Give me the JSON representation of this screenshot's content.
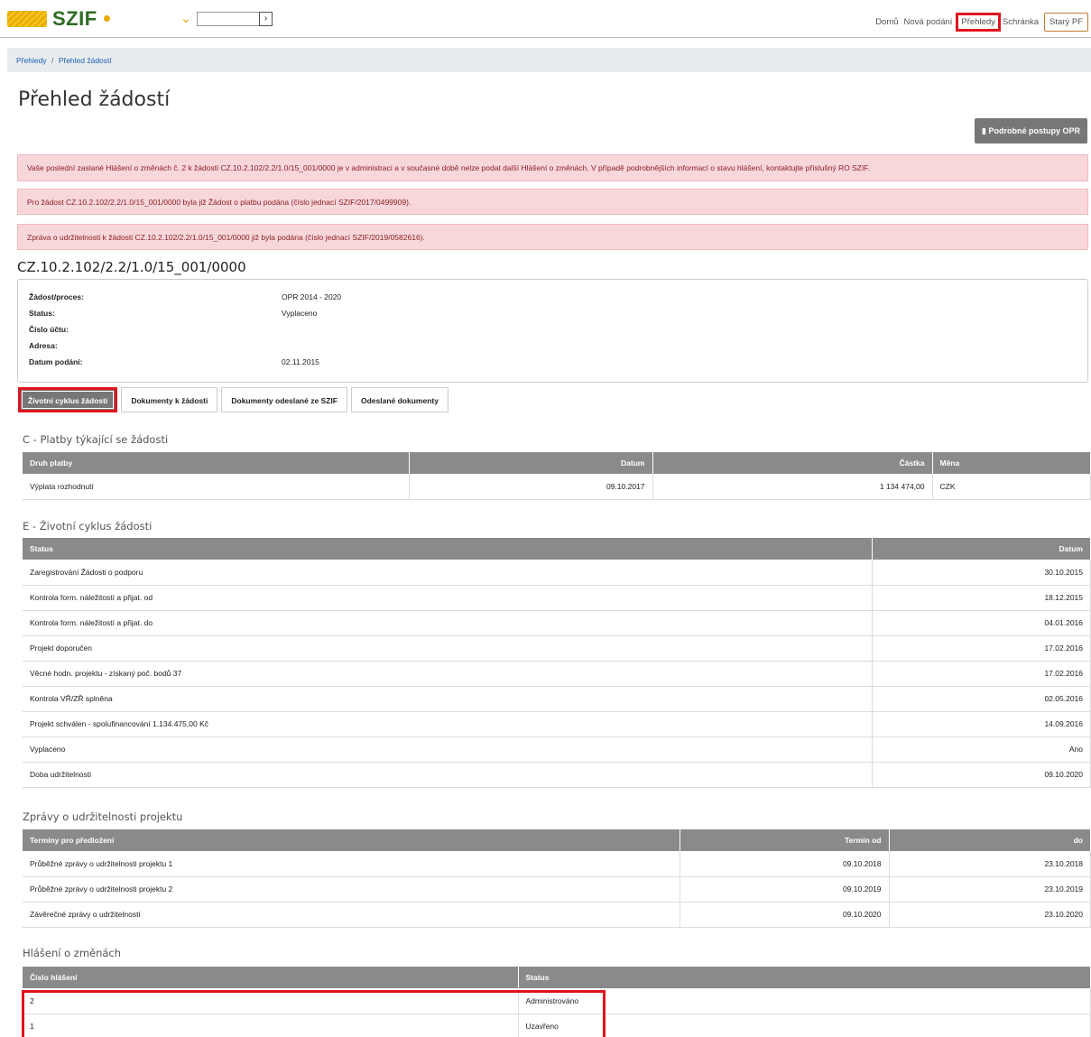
{
  "header": {
    "logo_text": "SZIF",
    "nav": [
      "Domů",
      "Nová podání",
      "Přehledy",
      "Schránka"
    ],
    "old_portal": "Starý PF",
    "go_symbol": "›"
  },
  "breadcrumb": [
    "Přehledy",
    "Přehled žádostí"
  ],
  "breadcrumb_sep": "/",
  "page_title": "Přehled žádostí",
  "postupy_button": "Podrobné postupy OPR",
  "alerts": [
    "Vaše poslední zaslané Hlášení o změnách č. 2 k žádosti CZ.10.2.102/2.2/1.0/15_001/0000     je v administraci a v současné době nelze podat další Hlášení o změnách. V případě podrobnějších informací o stavu hlášení, kontaktujte příslušný RO SZIF.",
    "Pro žádost CZ.10.2.102/2.2/1.0/15_001/0000     byla již Žádost o platbu podána (číslo jednací SZIF/2017/0499909).",
    "Zpráva o udržitelnosti k žádosti CZ.10.2.102/2.2/1.0/15_001/0000     již byla podána (číslo jednací SZIF/2019/0582616)."
  ],
  "application_id": "CZ.10.2.102/2.2/1.0/15_001/0000",
  "info": [
    {
      "key": "Žádost/proces:",
      "value": "OPR 2014 - 2020"
    },
    {
      "key": "Status:",
      "value": "Vyplaceno"
    },
    {
      "key": "Číslo účtu:",
      "value": ""
    },
    {
      "key": "Adresa:",
      "value": ""
    },
    {
      "key": "Datum podání:",
      "value": "02.11.2015"
    }
  ],
  "tabs": [
    "Životní cyklus žádosti",
    "Dokumenty k žádosti",
    "Dokumenty odeslané ze SZIF",
    "Odeslané dokumenty"
  ],
  "payments": {
    "title": "C - Platby týkající se žádosti",
    "headers": [
      "Druh platby",
      "Datum",
      "Částka",
      "Měna"
    ],
    "rows": [
      [
        "Výplata rozhodnutí",
        "09.10.2017",
        "1 134 474,00",
        "CZK"
      ]
    ]
  },
  "lifecycle": {
    "title": "E - Životní cyklus žádosti",
    "headers": [
      "Status",
      "Datum"
    ],
    "rows": [
      [
        "Zaregistrování Žádosti o podporu",
        "30.10.2015"
      ],
      [
        "Kontrola form. náležitostí a přijat. od",
        "18.12.2015"
      ],
      [
        "Kontrola form. náležitostí a přijat. do",
        "04.01.2016"
      ],
      [
        "Projekt doporučen",
        "17.02.2016"
      ],
      [
        "Věcné hodn. projektu - získaný poč. bodů 37",
        "17.02.2016"
      ],
      [
        "Kontrola VŘ/ZŘ splněna",
        "02.05.2016"
      ],
      [
        "Projekt schválen - spolufinancování 1.134.475,00 Kč",
        "14.09.2016"
      ],
      [
        "Vyplaceno",
        "Ano"
      ],
      [
        "Doba udržitelnosti",
        "09.10.2020"
      ]
    ]
  },
  "sustainability": {
    "title": "Zprávy o udržitelnosti projektu",
    "headers": [
      "Termíny pro předložení",
      "Termín od",
      "do"
    ],
    "rows": [
      [
        "Průběžné zprávy o udržitelnosti projektu 1",
        "09.10.2018",
        "23.10.2018"
      ],
      [
        "Průběžné zprávy o udržitelnosti projektu 2",
        "09.10.2019",
        "23.10.2019"
      ],
      [
        "Závěrečné zprávy o udržitelnosti",
        "09.10.2020",
        "23.10.2020"
      ]
    ]
  },
  "changes": {
    "title": "Hlášení o změnách",
    "headers": [
      "Číslo hlášení",
      "Status"
    ],
    "rows": [
      [
        "2",
        "Administrováno"
      ],
      [
        "1",
        "Uzavřeno"
      ]
    ]
  },
  "colors": {
    "highlight": "#e0141e",
    "header_bg": "#8a8a8a",
    "alert_bg": "#f8d7da",
    "brand_green": "#2d6b22",
    "brand_yellow": "#e5a900"
  },
  "icons": {
    "user": "user-icon",
    "chevron": "chevron-down-icon",
    "document": "document-icon"
  }
}
